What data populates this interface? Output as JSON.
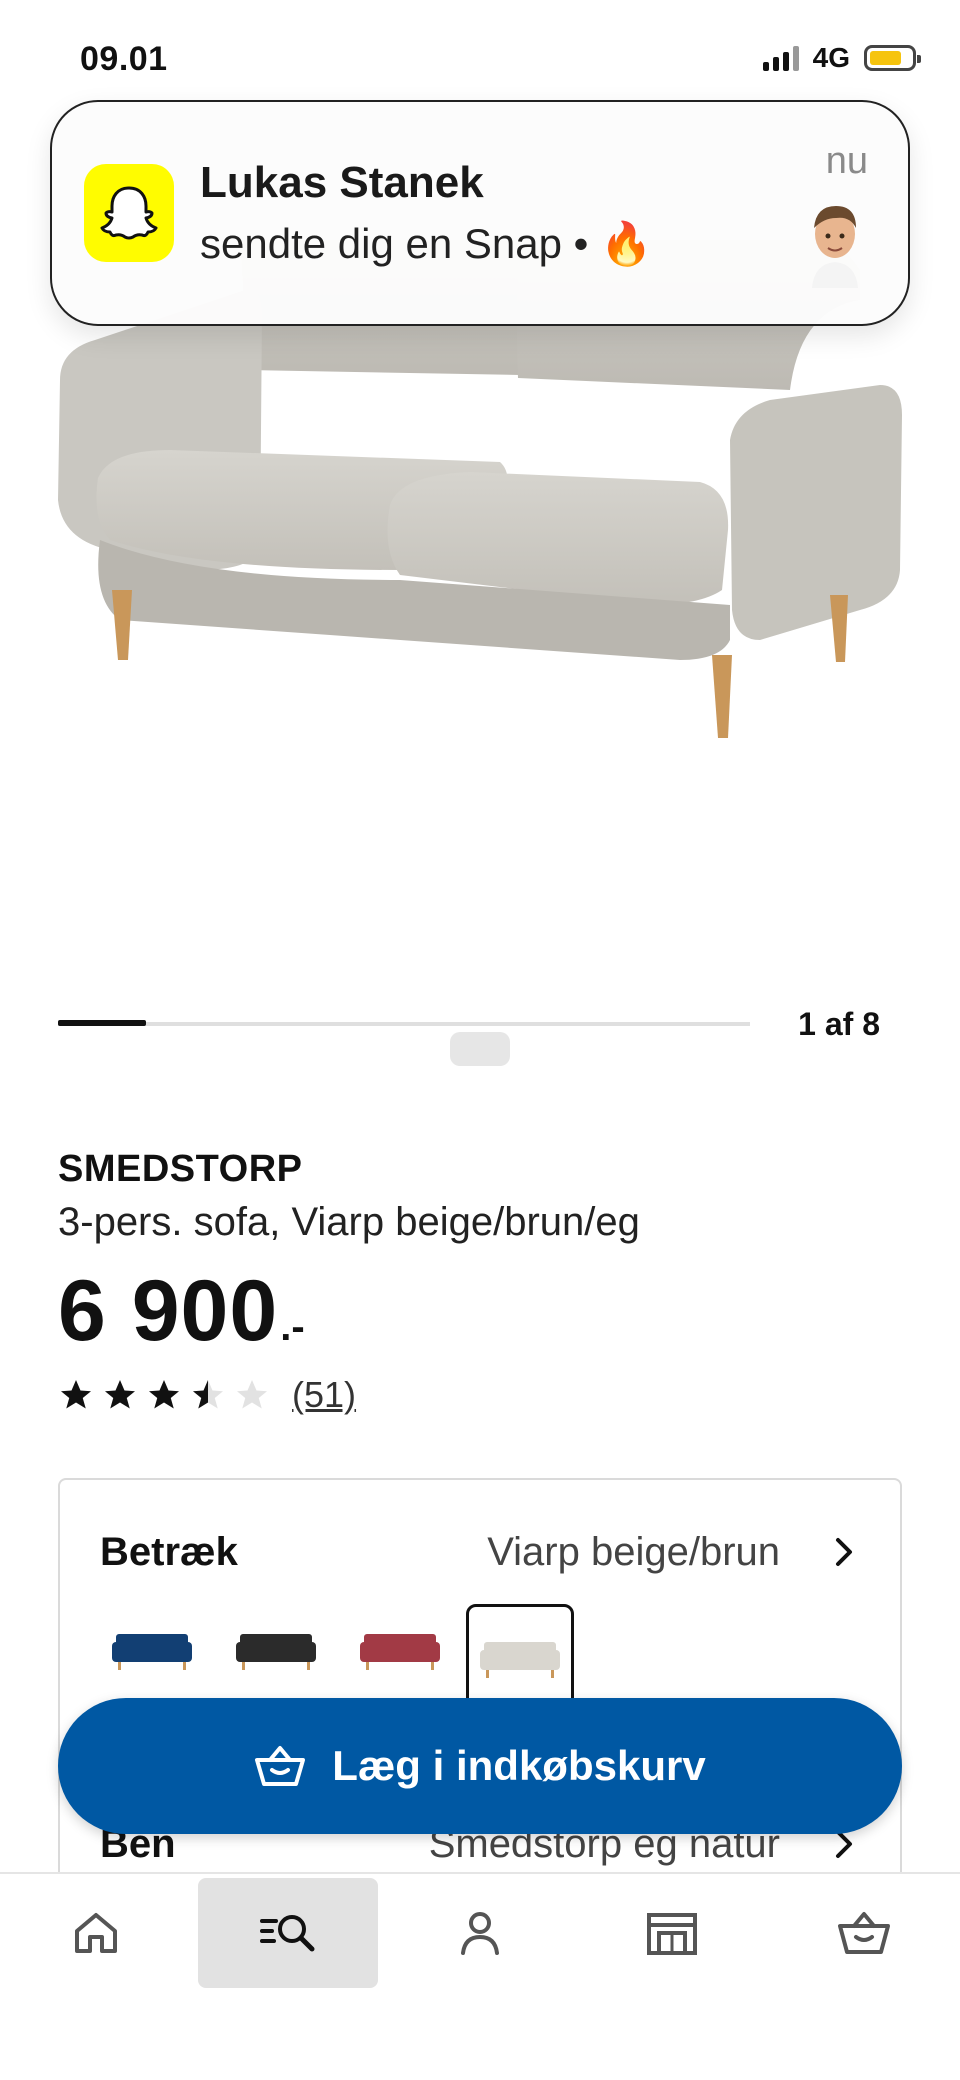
{
  "status_bar": {
    "time": "09.01",
    "network": "4G",
    "battery_level": 0.78,
    "battery_color": "#f6c40e"
  },
  "notification": {
    "app_icon": "snapchat-ghost-icon",
    "app_color": "#fffc00",
    "title": "Lukas Stanek",
    "body": "sendte dig en Snap • 🔥",
    "time": "nu",
    "avatar_icon": "bitmoji-avatar-icon"
  },
  "carousel": {
    "counter": "1 af 8",
    "current": 1,
    "total": 8
  },
  "product": {
    "name": "SMEDSTORP",
    "description": "3-pers. sofa, Viarp beige/brun/eg",
    "price": "6 900",
    "price_suffix": ".-",
    "rating": 3.5,
    "rating_max": 5,
    "review_count": "(51)"
  },
  "configurator": {
    "cover": {
      "label": "Betræk",
      "value": "Viarp beige/brun",
      "swatches": [
        {
          "name": "blue",
          "color": "#123f73",
          "selected": false
        },
        {
          "name": "black",
          "color": "#2b2b2b",
          "selected": false
        },
        {
          "name": "red",
          "color": "#a23a45",
          "selected": false
        },
        {
          "name": "beige",
          "color": "#d9d6cf",
          "selected": true
        }
      ]
    },
    "legs": {
      "label": "Ben",
      "value": "Smedstorp  eg natur"
    }
  },
  "cta": {
    "label": "Læg i indkøbskurv",
    "color": "#0058a3",
    "icon": "shopping-basket-icon"
  },
  "bottom_nav": {
    "items": [
      {
        "name": "home",
        "icon": "home-icon",
        "active": false
      },
      {
        "name": "search",
        "icon": "search-list-icon",
        "active": true
      },
      {
        "name": "profile",
        "icon": "person-icon",
        "active": false
      },
      {
        "name": "store",
        "icon": "store-icon",
        "active": false
      },
      {
        "name": "cart",
        "icon": "basket-icon",
        "active": false
      }
    ]
  }
}
